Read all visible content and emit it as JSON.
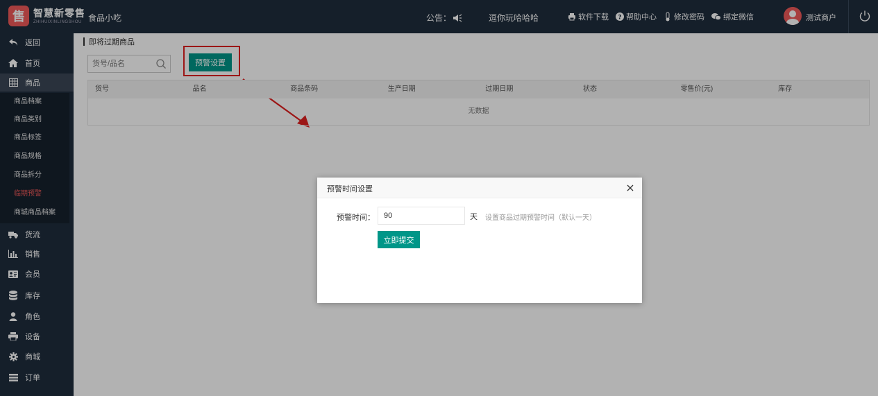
{
  "app": {
    "logo_mark": "售",
    "logo_title": "智慧新零售",
    "logo_subtitle": "ZHIHUIXINLINGSHOU",
    "shop_name": "食品小吃"
  },
  "topbar": {
    "notice_label": "公告：",
    "marquee_text": "逗你玩哈哈哈",
    "links": [
      {
        "label": "软件下载",
        "icon": "printer-icon"
      },
      {
        "label": "帮助中心",
        "icon": "help-icon"
      },
      {
        "label": "修改密码",
        "icon": "thermometer-icon"
      },
      {
        "label": "绑定微信",
        "icon": "chat-icon"
      }
    ],
    "user_name": "测试商户"
  },
  "sidebar": {
    "items": [
      {
        "label": "返回",
        "icon": "back-icon"
      },
      {
        "label": "首页",
        "icon": "home-icon"
      },
      {
        "label": "商品",
        "icon": "grid-icon"
      },
      {
        "label": "货流",
        "icon": "truck-icon"
      },
      {
        "label": "销售",
        "icon": "bar-chart-icon"
      },
      {
        "label": "会员",
        "icon": "id-card-icon"
      },
      {
        "label": "库存",
        "icon": "database-icon"
      },
      {
        "label": "角色",
        "icon": "user-icon"
      },
      {
        "label": "设备",
        "icon": "printer-icon"
      },
      {
        "label": "商城",
        "icon": "gear-icon"
      },
      {
        "label": "订单",
        "icon": "list-icon"
      }
    ],
    "sub_items": [
      "商品档案",
      "商品类别",
      "商品标签",
      "商品规格",
      "商品拆分",
      "临期预警",
      "商城商品档案"
    ],
    "current_sub_index": 5
  },
  "main": {
    "breadcrumb": "即将过期商品",
    "search_placeholder": "货号/品名",
    "warn_button": "预警设置",
    "columns": [
      "货号",
      "品名",
      "商品条码",
      "生产日期",
      "过期日期",
      "状态",
      "零售价(元)",
      "库存"
    ],
    "empty_text": "无数据"
  },
  "modal": {
    "title": "预警时间设置",
    "field_label": "预警时间：",
    "field_value": "90",
    "unit": "天",
    "hint": "设置商品过期预警时间（默认一天）",
    "submit": "立即提交"
  },
  "colors": {
    "nav_bg": "#1f2d3d",
    "accent": "#009688",
    "highlight": "#e02020",
    "brand": "#f05a5a"
  }
}
